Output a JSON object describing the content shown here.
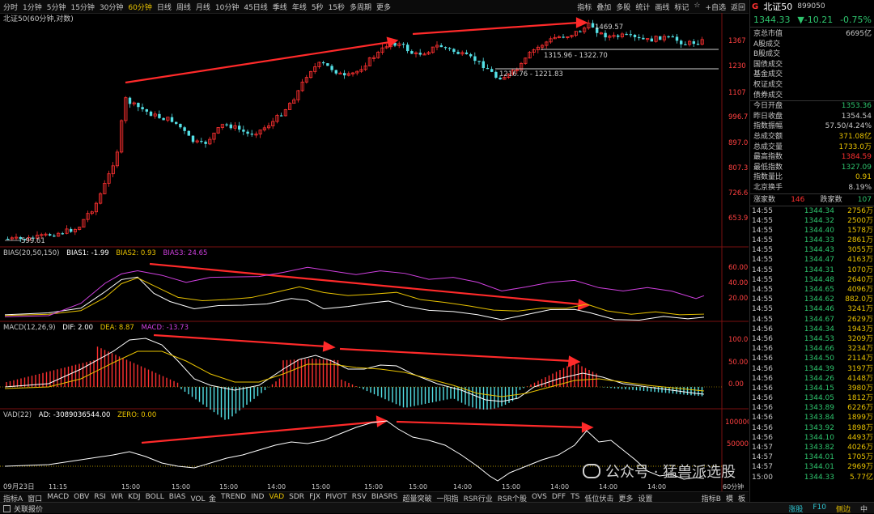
{
  "toolbar": {
    "periods": [
      "分时",
      "1分钟",
      "5分钟",
      "15分钟",
      "30分钟",
      "60分钟",
      "日线",
      "周线",
      "月线",
      "10分钟",
      "45日线",
      "季线",
      "年线",
      "5秒",
      "15秒",
      "多周期",
      "更多"
    ],
    "active_period": "60分钟",
    "right_tools": [
      "指标",
      "叠加",
      "多股",
      "统计",
      "画线",
      "标记",
      "☆",
      "+自选",
      "返回"
    ]
  },
  "chart": {
    "title": "北证50(60分钟,对数)",
    "price_axis": [
      "1367",
      "1230",
      "1107",
      "996.7",
      "897.0",
      "807.3",
      "726.6",
      "653.9"
    ],
    "annotations": {
      "high": "1469.57",
      "low": "599.61",
      "range1": "1315.96 - 1322.70",
      "range2": "1216.76 - 1221.83"
    },
    "date_label": "09月23日",
    "time_labels": [
      "11:15",
      "15:00",
      "15:00",
      "15:00",
      "14:00",
      "15:00",
      "15:00",
      "15:00",
      "14:00",
      "15:00",
      "14:00",
      "14:00",
      "14:00"
    ],
    "axis_corner": "60分钟"
  },
  "bias": {
    "header": "BIAS(20,50,150)",
    "bias1": "BIAS1: -1.99",
    "bias2": "BIAS2: 0.93",
    "bias3": "BIAS3: 24.65",
    "axis": [
      "60.00",
      "40.00",
      "20.00"
    ]
  },
  "macd": {
    "header": "MACD(12,26,9)",
    "dif": "DIF: 2.00",
    "dea": "DEA: 8.87",
    "macd": "MACD: -13.73",
    "axis": [
      "100.0",
      "50.00",
      "0.00"
    ]
  },
  "vad": {
    "header": "VAD(22)",
    "ad": "AD: -3089036544.00",
    "zero": "ZERO: 0.00",
    "axis": [
      "100000",
      "50000"
    ]
  },
  "indicator_tabs": [
    "指标A",
    "窗口",
    "MACD",
    "OBV",
    "RSI",
    "WR",
    "KDJ",
    "BOLL",
    "BIAS",
    "VOL_金",
    "TREND",
    "IND",
    "VAD",
    "SDR",
    "FJX",
    "PIVOT",
    "RSV",
    "BIASRS",
    "超量突破",
    "一阳指",
    "RSR行业",
    "RSR个股",
    "OVS",
    "DFF",
    "TS",
    "低位伏击",
    "更多",
    "设置"
  ],
  "active_indicator": "VAD",
  "panel_tabs_right": [
    "指标B",
    "模",
    "板"
  ],
  "watermark": "公众号 · 猛兽派选股",
  "status": {
    "left": "关联报价",
    "right": [
      "涨股",
      "F10",
      "侧边",
      "中"
    ]
  },
  "quote": {
    "g": "G",
    "name": "北证50",
    "code": "899050",
    "price": "1344.33",
    "change": "▼-10.21",
    "pct": "-0.75%",
    "market_cap_label": "京总市值",
    "market_cap": "6695亿",
    "sub_items": [
      "A股成交",
      "B股成交",
      "国债成交",
      "基金成交",
      "权证成交",
      "债券成交"
    ],
    "stats": [
      {
        "k": "今日开盘",
        "v": "1353.36",
        "c": "#2ec46d"
      },
      {
        "k": "昨日收盘",
        "v": "1354.54",
        "c": "#c8c8c8"
      },
      {
        "k": "指数振幅",
        "v": "57.50/4.24%",
        "c": "#c8c8c8"
      },
      {
        "k": "总成交额",
        "v": "371.08亿",
        "c": "#e8c200"
      },
      {
        "k": "总成交量",
        "v": "1733.0万",
        "c": "#e8c200"
      },
      {
        "k": "最高指数",
        "v": "1384.59",
        "c": "#ff3030"
      },
      {
        "k": "最低指数",
        "v": "1327.09",
        "c": "#2ec46d"
      },
      {
        "k": "指数量比",
        "v": "0.91",
        "c": "#e8c200"
      },
      {
        "k": "北京换手",
        "v": "8.19%",
        "c": "#c8c8c8"
      }
    ],
    "up_label": "涨家数",
    "up": "146",
    "down_label": "跌家数",
    "down": "107"
  },
  "ticks": [
    {
      "t": "14:55",
      "p": "1344.34",
      "v": "2756万"
    },
    {
      "t": "14:55",
      "p": "1344.32",
      "v": "2500万"
    },
    {
      "t": "14:55",
      "p": "1344.40",
      "v": "1578万"
    },
    {
      "t": "14:55",
      "p": "1344.33",
      "v": "2861万"
    },
    {
      "t": "14:55",
      "p": "1344.43",
      "v": "3055万"
    },
    {
      "t": "14:55",
      "p": "1344.47",
      "v": "4163万"
    },
    {
      "t": "14:55",
      "p": "1344.31",
      "v": "1070万"
    },
    {
      "t": "14:55",
      "p": "1344.48",
      "v": "2640万"
    },
    {
      "t": "14:55",
      "p": "1344.65",
      "v": "4096万"
    },
    {
      "t": "14:55",
      "p": "1344.62",
      "v": "882.0万"
    },
    {
      "t": "14:55",
      "p": "1344.46",
      "v": "3241万"
    },
    {
      "t": "14:55",
      "p": "1344.67",
      "v": "2629万"
    },
    {
      "t": "14:56",
      "p": "1344.34",
      "v": "1943万"
    },
    {
      "t": "14:56",
      "p": "1344.53",
      "v": "3209万"
    },
    {
      "t": "14:56",
      "p": "1344.66",
      "v": "3234万"
    },
    {
      "t": "14:56",
      "p": "1344.50",
      "v": "2114万"
    },
    {
      "t": "14:56",
      "p": "1344.39",
      "v": "3197万"
    },
    {
      "t": "14:56",
      "p": "1344.26",
      "v": "4148万"
    },
    {
      "t": "14:56",
      "p": "1344.15",
      "v": "3980万"
    },
    {
      "t": "14:56",
      "p": "1344.05",
      "v": "1812万"
    },
    {
      "t": "14:56",
      "p": "1343.89",
      "v": "6226万"
    },
    {
      "t": "14:56",
      "p": "1343.84",
      "v": "1899万"
    },
    {
      "t": "14:56",
      "p": "1343.92",
      "v": "1898万"
    },
    {
      "t": "14:56",
      "p": "1344.10",
      "v": "4493万"
    },
    {
      "t": "14:57",
      "p": "1343.82",
      "v": "4026万"
    },
    {
      "t": "14:57",
      "p": "1344.01",
      "v": "1705万"
    },
    {
      "t": "14:57",
      "p": "1344.01",
      "v": "2969万"
    },
    {
      "t": "15:00",
      "p": "1344.33",
      "v": "5.77亿"
    }
  ]
}
